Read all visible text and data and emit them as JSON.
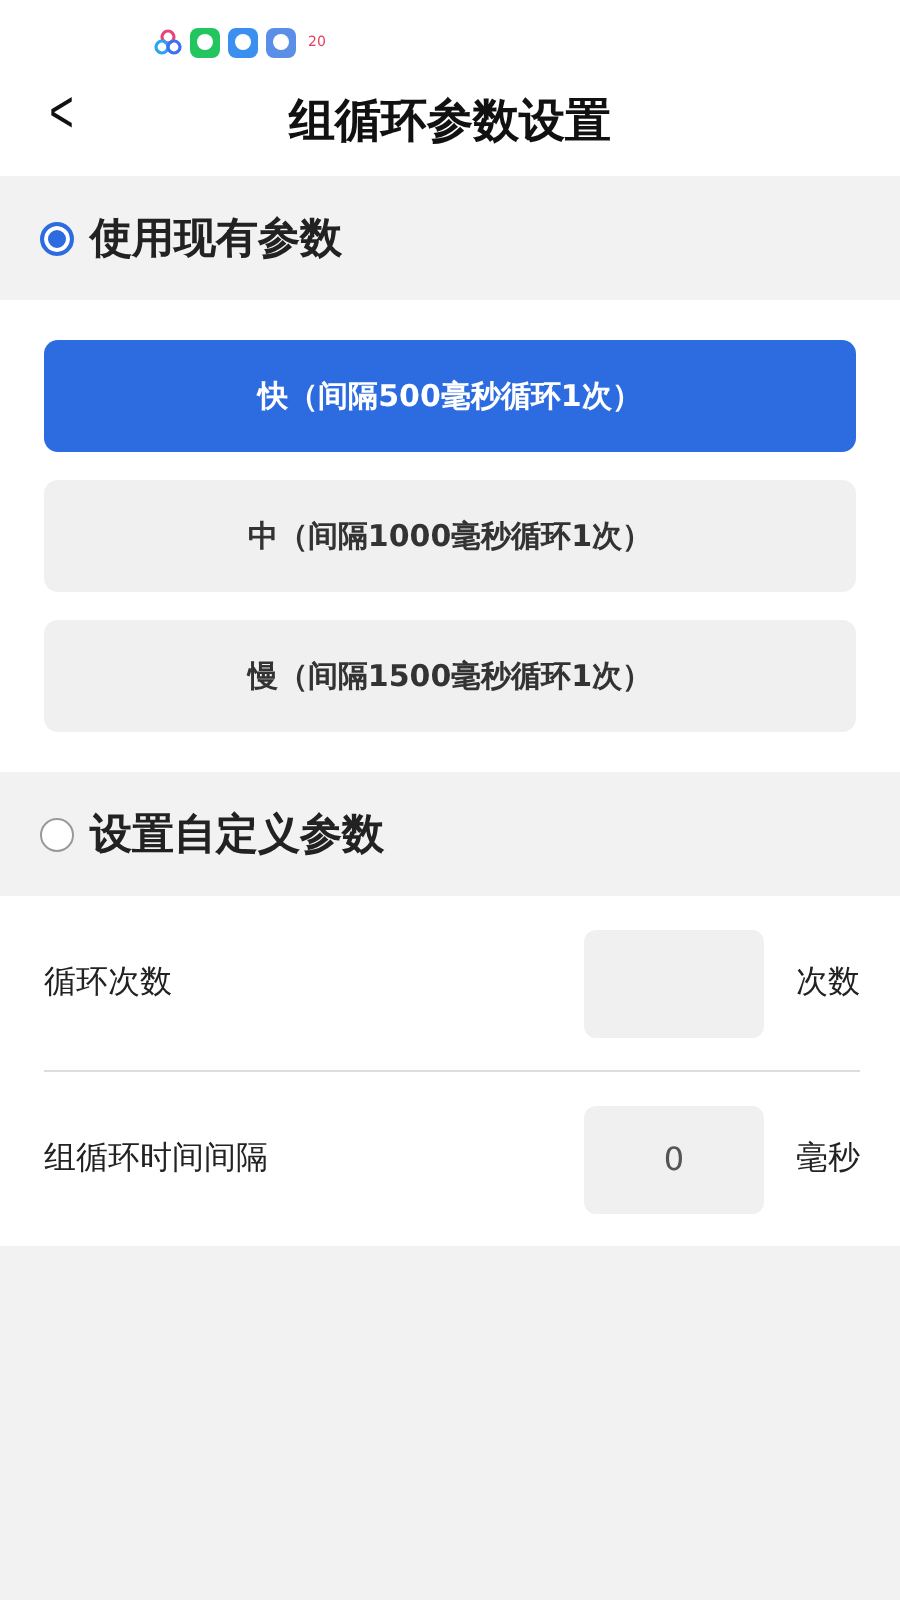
{
  "status_bar": {
    "app_icons": [
      {
        "kind": "rings"
      },
      {
        "kind": "chat"
      },
      {
        "kind": "weather"
      },
      {
        "kind": "store"
      },
      {
        "kind": "calendar",
        "text": "20"
      }
    ]
  },
  "header": {
    "back": "<",
    "title": "组循环参数设置"
  },
  "preset_section": {
    "label": "使用现有参数",
    "selected": true,
    "options": [
      {
        "label": "快（间隔500毫秒循环1次）",
        "selected": true
      },
      {
        "label": "中（间隔1000毫秒循环1次）",
        "selected": false
      },
      {
        "label": "慢（间隔1500毫秒循环1次）",
        "selected": false
      }
    ]
  },
  "custom_section": {
    "label": "设置自定义参数",
    "selected": false,
    "fields": [
      {
        "label": "循环次数",
        "unit": "次数"
      },
      {
        "label": "组循环时间间隔",
        "value": "0",
        "unit": "毫秒"
      }
    ]
  }
}
